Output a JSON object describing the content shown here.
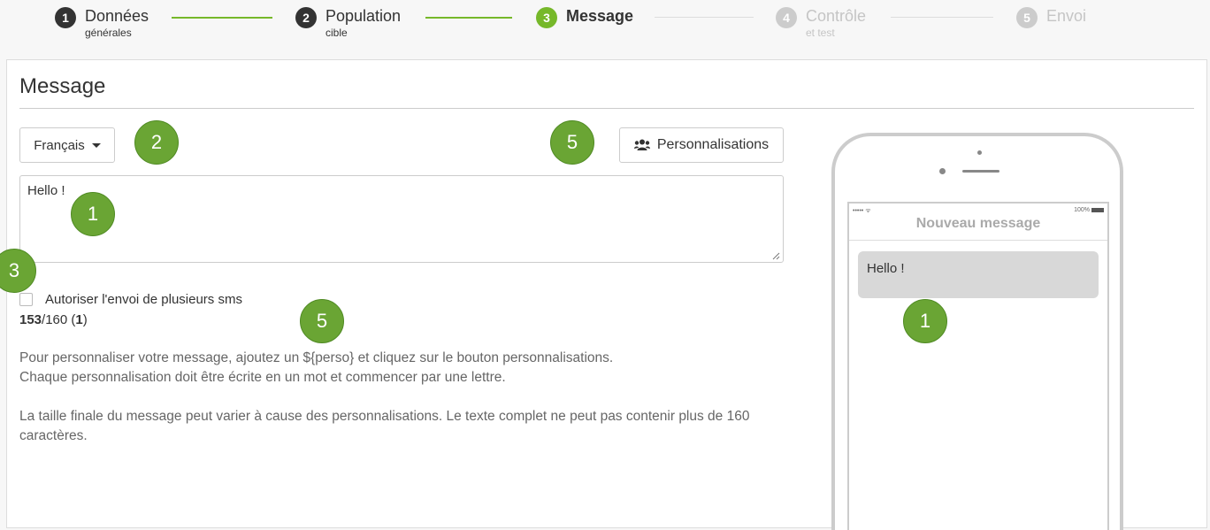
{
  "stepper": {
    "steps": [
      {
        "num": "1",
        "title": "Données",
        "sub": "générales"
      },
      {
        "num": "2",
        "title": "Population",
        "sub": "cible"
      },
      {
        "num": "3",
        "title": "Message",
        "sub": ""
      },
      {
        "num": "4",
        "title": "Contrôle",
        "sub": "et test"
      },
      {
        "num": "5",
        "title": "Envoi",
        "sub": ""
      }
    ]
  },
  "panel": {
    "title": "Message",
    "language_label": "Français",
    "perso_button_label": "Personnalisations",
    "message_value": "Hello !",
    "multi_sms_label": "Autoriser l'envoi de plusieurs sms",
    "counter": {
      "remaining": "153",
      "rest": "/160 (",
      "count": "1",
      "close": ")"
    },
    "help": {
      "line1": "Pour personnaliser votre message, ajoutez un ${perso} et cliquez sur le bouton personnalisations.",
      "line2": "Chaque personnalisation doit être écrite en un mot et commencer par une lettre.",
      "line3": "La taille finale du message peut varier à cause des personnalisations. Le texte complet ne peut pas contenir plus de 160 caractères."
    }
  },
  "phone": {
    "status_left": "••••• ᯤ",
    "status_right": "100%",
    "title": "Nouveau message",
    "bubble_text": "Hello !"
  },
  "annotations": {
    "b_message": "1",
    "b_language": "2",
    "b_multi": "3",
    "b_perso": "5",
    "b_counter": "5",
    "b_preview": "1"
  },
  "colors": {
    "accent": "#76b82a",
    "badge": "#6aa534",
    "done_step": "#333333",
    "todo_step": "#cccccc"
  }
}
